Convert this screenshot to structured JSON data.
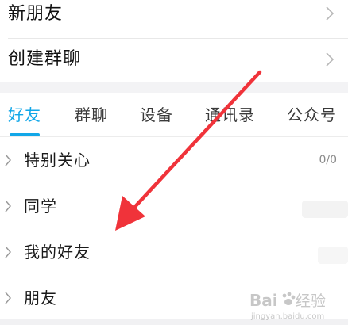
{
  "menu": {
    "new_friend": "新朋友",
    "create_group_chat": "创建群聊"
  },
  "tabs": [
    {
      "label": "好友",
      "active": true
    },
    {
      "label": "群聊",
      "active": false
    },
    {
      "label": "设备",
      "active": false
    },
    {
      "label": "通讯录",
      "active": false
    },
    {
      "label": "公众号",
      "active": false
    }
  ],
  "groups": [
    {
      "label": "特别关心",
      "count": "0/0"
    },
    {
      "label": "同学",
      "count": ""
    },
    {
      "label": "我的好友",
      "count": ""
    },
    {
      "label": "朋友",
      "count": ""
    }
  ],
  "colors": {
    "accent": "#12a7e8",
    "annotation_arrow": "#f0333a"
  },
  "icons": {
    "row_chevron": "chevron-right-icon",
    "group_chevron": "chevron-right-icon"
  },
  "watermark": {
    "brand": "Baidu 经验",
    "url": "jingyan.baidu.com"
  }
}
